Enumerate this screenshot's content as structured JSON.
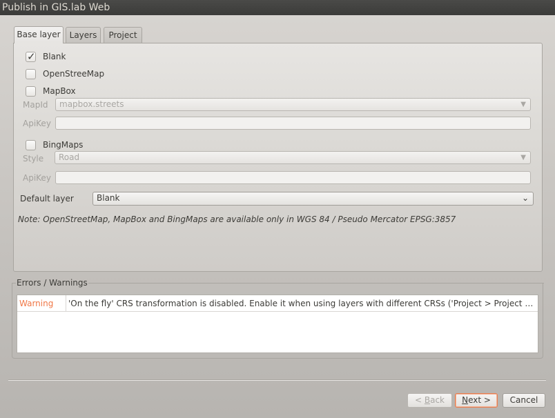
{
  "window": {
    "title": "Publish in GIS.lab Web"
  },
  "tabs": [
    {
      "label": "Base layer",
      "active": true
    },
    {
      "label": "Layers",
      "active": false
    },
    {
      "label": "Project",
      "active": false
    }
  ],
  "base_layer": {
    "blank": {
      "label": "Blank",
      "checked": true
    },
    "osm": {
      "label": "OpenStreeMap",
      "checked": false
    },
    "mapbox": {
      "label": "MapBox",
      "checked": false,
      "mapid_label": "MapId",
      "mapid_value": "mapbox.streets",
      "apikey_label": "ApiKey",
      "apikey_value": ""
    },
    "bing": {
      "label": "BingMaps",
      "checked": false,
      "style_label": "Style",
      "style_value": "Road",
      "apikey_label": "ApiKey",
      "apikey_value": ""
    },
    "default_layer": {
      "label": "Default layer",
      "value": "Blank"
    },
    "note": "Note: OpenStreetMap, MapBox and BingMaps are available only in WGS 84 / Pseudo Mercator EPSG:3857"
  },
  "errors": {
    "title": "Errors / Warnings",
    "messages": [
      {
        "level": "Warning",
        "text": "'On the fly' CRS transformation is disabled. Enable it when using layers with different CRSs ('Project > Project Properties > CRS')"
      }
    ]
  },
  "buttons": {
    "back": {
      "prefix": "< ",
      "accel": "B",
      "rest": "ack"
    },
    "next": {
      "accel": "N",
      "rest": "ext >"
    },
    "cancel": {
      "label": "Cancel"
    }
  },
  "icons": {
    "check": "check-icon",
    "dropdown": "chevron-down-icon"
  },
  "colors": {
    "warning": "#f07746",
    "accent": "#e67d4f",
    "titlebar": "#3c3b37"
  }
}
